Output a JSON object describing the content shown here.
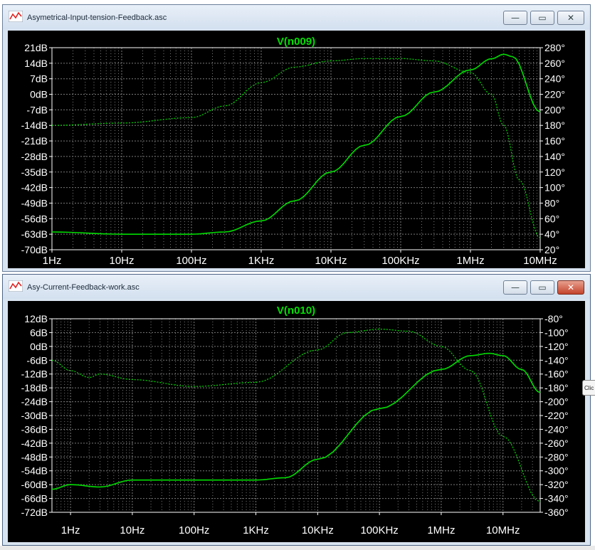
{
  "windows": [
    {
      "title": "Asymetrical-Input-tension-Feedback.asc",
      "buttons": {
        "minimize": "—",
        "maximize": "▭",
        "close": "✕"
      },
      "chart_data": {
        "type": "line",
        "title": "V(n009)",
        "x_scale": "log",
        "xlim": [
          1,
          10000000
        ],
        "x_ticks": [
          "1Hz",
          "10Hz",
          "100Hz",
          "1KHz",
          "10KHz",
          "100KHz",
          "1MHz",
          "10MHz"
        ],
        "ylim": [
          -70,
          21
        ],
        "y_ticks": [
          "21dB",
          "14dB",
          "7dB",
          "0dB",
          "-7dB",
          "-14dB",
          "-21dB",
          "-28dB",
          "-35dB",
          "-42dB",
          "-49dB",
          "-56dB",
          "-63dB",
          "-70dB"
        ],
        "y2lim": [
          20,
          280
        ],
        "y2_ticks": [
          "280°",
          "260°",
          "240°",
          "220°",
          "200°",
          "180°",
          "160°",
          "140°",
          "120°",
          "100°",
          "80°",
          "60°",
          "40°",
          "20°"
        ],
        "grid": true,
        "series": [
          {
            "axis": "left",
            "style": "solid",
            "color": "#00dd00",
            "x": [
              1,
              10,
              100,
              300,
              1000,
              3000,
              10000,
              30000,
              100000,
              300000,
              1000000,
              2000000,
              3000000,
              4000000,
              10000000
            ],
            "y": [
              -62,
              -63,
              -63,
              -62,
              -57,
              -48,
              -35,
              -23,
              -10,
              1,
              11,
              16,
              18,
              17,
              -8
            ]
          },
          {
            "axis": "right",
            "style": "dashed",
            "color": "#00dd00",
            "x": [
              1,
              10,
              100,
              300,
              1000,
              3000,
              10000,
              30000,
              100000,
              300000,
              1000000,
              2000000,
              3000000,
              5000000,
              10000000
            ],
            "y": [
              180,
              183,
              190,
              205,
              235,
              255,
              263,
              266,
              266,
              263,
              248,
              220,
              180,
              110,
              35
            ]
          }
        ]
      }
    },
    {
      "title": "Asy-Current-Feedback-work.asc",
      "buttons": {
        "minimize": "—",
        "maximize": "▭",
        "close": "✕"
      },
      "chart_data": {
        "type": "line",
        "title": "V(n010)",
        "x_scale": "log",
        "xlim": [
          0.5,
          40000000
        ],
        "x_ticks": [
          "1Hz",
          "10Hz",
          "100Hz",
          "1KHz",
          "10KHz",
          "100KHz",
          "1MHz",
          "10MHz"
        ],
        "ylim": [
          -72,
          12
        ],
        "y_ticks": [
          "12dB",
          "6dB",
          "0dB",
          "-6dB",
          "-12dB",
          "-18dB",
          "-24dB",
          "-30dB",
          "-36dB",
          "-42dB",
          "-48dB",
          "-54dB",
          "-60dB",
          "-66dB",
          "-72dB"
        ],
        "y2lim": [
          -360,
          -80
        ],
        "y2_ticks": [
          "-80°",
          "-100°",
          "-120°",
          "-140°",
          "-160°",
          "-180°",
          "-200°",
          "-220°",
          "-240°",
          "-260°",
          "-280°",
          "-300°",
          "-320°",
          "-340°",
          "-360°"
        ],
        "grid": true,
        "series": [
          {
            "axis": "left",
            "style": "solid",
            "color": "#00dd00",
            "x": [
              0.5,
              1,
              3,
              10,
              100,
              1000,
              3000,
              10000,
              100000,
              1000000,
              3000000,
              6000000,
              10000000,
              20000000,
              40000000
            ],
            "y": [
              -62,
              -60,
              -61,
              -58,
              -58,
              -58,
              -57,
              -49,
              -27,
              -10,
              -4,
              -3,
              -4,
              -10,
              -20
            ]
          },
          {
            "axis": "right",
            "style": "dashed",
            "color": "#00dd00",
            "x": [
              0.5,
              1,
              2,
              3,
              10,
              100,
              1000,
              10000,
              30000,
              100000,
              300000,
              1000000,
              3000000,
              10000000,
              40000000
            ],
            "y": [
              -140,
              -155,
              -165,
              -160,
              -168,
              -178,
              -172,
              -125,
              -100,
              -95,
              -98,
              -120,
              -155,
              -250,
              -345
            ]
          }
        ]
      }
    }
  ],
  "tooltip": "Clic"
}
